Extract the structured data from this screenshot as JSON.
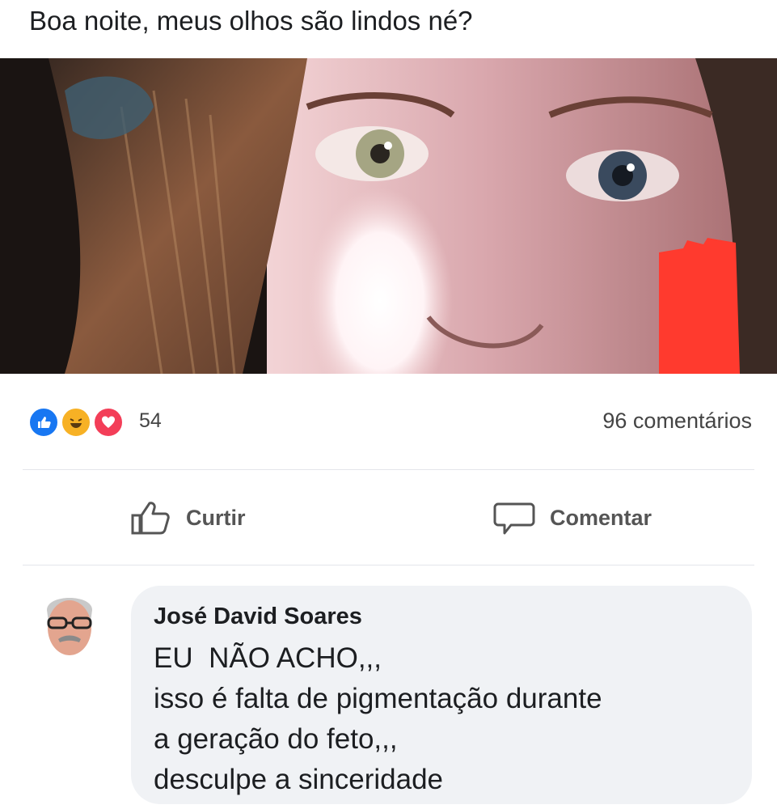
{
  "post": {
    "text": "Boa noite, meus olhos são lindos né?"
  },
  "reactions": {
    "icons": [
      "like-icon",
      "haha-icon",
      "love-icon"
    ],
    "count": "54",
    "comments_count": "96 comentários"
  },
  "actions": {
    "like_label": "Curtir",
    "comment_label": "Comentar"
  },
  "comment": {
    "author": "José David Soares",
    "lines": [
      "EU  NÃO ACHO,,,",
      "isso é falta de pigmentação durante",
      "a geração do feto,,,",
      "desculpe a sinceridade"
    ]
  },
  "colors": {
    "like": "#1877f2",
    "haha": "#f7b125",
    "love": "#f33e58",
    "bubble": "#f0f2f5"
  }
}
